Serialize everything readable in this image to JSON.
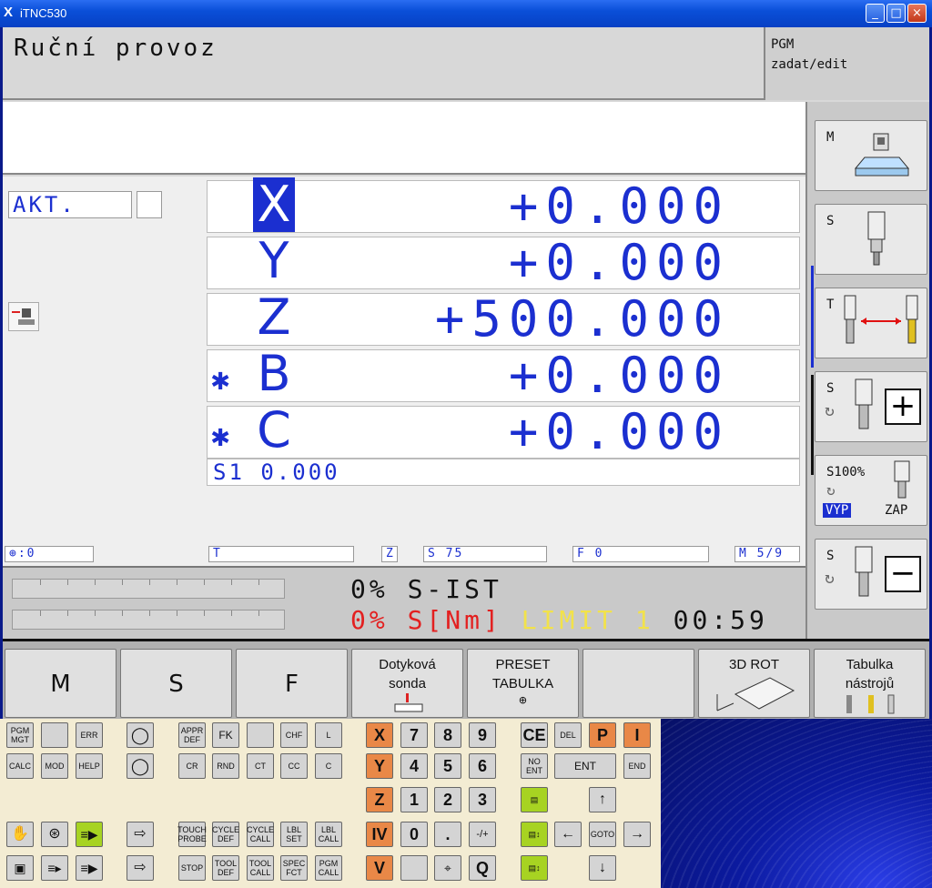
{
  "window": {
    "title": "iTNC530",
    "minimize": "_",
    "maximize": "□",
    "close": "×"
  },
  "header": {
    "mode": "Ruční provoz",
    "pgm_line1": "PGM",
    "pgm_line2": "zadat/edit"
  },
  "position": {
    "akt_label": "AKT.",
    "axes": [
      {
        "label": "X",
        "value": "+0.000",
        "selected": true,
        "clamped": false
      },
      {
        "label": "Y",
        "value": "+0.000",
        "selected": false,
        "clamped": false
      },
      {
        "label": "Z",
        "value": "+500.000",
        "selected": false,
        "clamped": false
      },
      {
        "label": "B",
        "value": "+0.000",
        "selected": false,
        "clamped": true
      },
      {
        "label": "C",
        "value": "+0.000",
        "selected": false,
        "clamped": true
      }
    ],
    "clamp_symbol": "✱",
    "s1": "S1  0.000"
  },
  "status": {
    "datum": ":0",
    "tool": "T",
    "tool_axis": "Z",
    "spindle": "S 75",
    "feed": "F 0",
    "mfunc": "M 5/9"
  },
  "load": {
    "row1": "0% S-IST",
    "row2_pct": "0%",
    "row2_label": "S[Nm]",
    "row2_limit": "LIMIT 1",
    "row2_time": "00:59"
  },
  "side_softkeys": [
    {
      "key": "M"
    },
    {
      "key": "S"
    },
    {
      "key": "T"
    },
    {
      "key": "S"
    },
    {
      "key": "S100%",
      "sub1": "VYP",
      "sub2": "ZAP"
    },
    {
      "key": "S"
    }
  ],
  "softkeys": [
    {
      "label": "M"
    },
    {
      "label": "S"
    },
    {
      "label": "F"
    },
    {
      "label1": "Dotyková",
      "label2": "sonda"
    },
    {
      "label1": "PRESET",
      "label2": "TABULKA"
    },
    {
      "label1": ""
    },
    {
      "label1": "3D ROT"
    },
    {
      "label1": "Tabulka",
      "label2": "nástrojů"
    }
  ],
  "keypad": {
    "k_pgm_mgt": "PGM MGT",
    "k_err": "ERR",
    "k_appr": "APPR DEF",
    "k_fk": "FK",
    "k_chf": "CHF",
    "k_l": "L",
    "k_calc": "CALC",
    "k_mod": "MOD",
    "k_help": "HELP",
    "k_cr": "CR",
    "k_rnd": "RND",
    "k_ct": "CT",
    "k_cc": "CC",
    "k_c": "C",
    "k_touch": "TOUCH PROBE",
    "k_cycle_def": "CYCLE DEF",
    "k_cycle_call": "CYCLE CALL",
    "k_lbl_set": "LBL SET",
    "k_lbl_call": "LBL CALL",
    "k_stop": "STOP",
    "k_tool_def": "TOOL DEF",
    "k_tool_call": "TOOL CALL",
    "k_spec": "SPEC FCT",
    "k_pgm_call": "PGM CALL",
    "ax_x": "X",
    "ax_y": "Y",
    "ax_z": "Z",
    "ax_iv": "IV",
    "ax_v": "V",
    "n7": "7",
    "n8": "8",
    "n9": "9",
    "n4": "4",
    "n5": "5",
    "n6": "6",
    "n1": "1",
    "n2": "2",
    "n3": "3",
    "n0": "0",
    "dot": ".",
    "pm": "-/+",
    "q": "Q",
    "k_ce": "CE",
    "k_del": "DEL",
    "k_p": "P",
    "k_i": "I",
    "k_no_ent": "NO ENT",
    "k_ent": "ENT",
    "k_end": "END",
    "k_goto": "GOTO"
  }
}
